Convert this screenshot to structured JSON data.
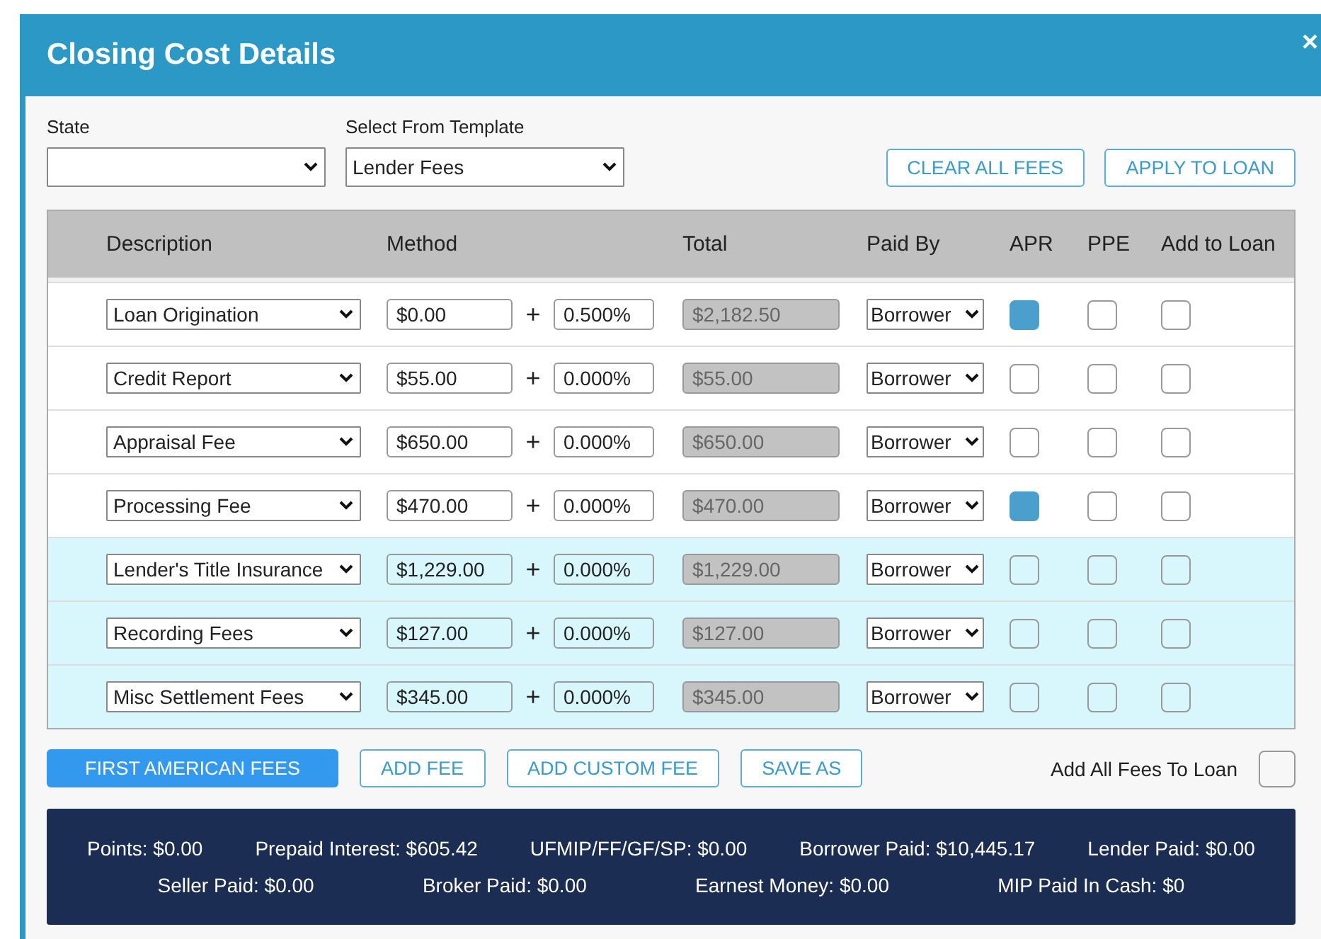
{
  "window": {
    "title": "Closing Cost Details",
    "close": "×"
  },
  "filters": [
    {
      "label": "State"
    },
    {
      "label": "Select From Template",
      "value": "Lender Fees"
    }
  ],
  "top_buttons": [
    "CLEAR ALL FEES",
    "APPLY TO LOAN"
  ],
  "table": {
    "columns": [
      "Description",
      "Method",
      "Total",
      "Paid By",
      "APR",
      "PPE",
      "Add to Loan"
    ],
    "rows": [
      {
        "description": "Loan Origination",
        "amount": "$0.00",
        "plus": "+",
        "percent": "0.500%",
        "total": "$2,182.50",
        "paid_by": "Borrower",
        "apr": true,
        "ppe": false,
        "add_to_loan": false,
        "highlighted": false
      },
      {
        "description": "Credit Report",
        "amount": "$55.00",
        "plus": "+",
        "percent": "0.000%",
        "total": "$55.00",
        "paid_by": "Borrower",
        "apr": false,
        "ppe": false,
        "add_to_loan": false,
        "highlighted": false
      },
      {
        "description": "Appraisal Fee",
        "amount": "$650.00",
        "plus": "+",
        "percent": "0.000%",
        "total": "$650.00",
        "paid_by": "Borrower",
        "apr": false,
        "ppe": false,
        "add_to_loan": false,
        "highlighted": false
      },
      {
        "description": "Processing Fee",
        "amount": "$470.00",
        "plus": "+",
        "percent": "0.000%",
        "total": "$470.00",
        "paid_by": "Borrower",
        "apr": true,
        "ppe": false,
        "add_to_loan": false,
        "highlighted": false
      },
      {
        "description": "Lender's Title Insurance",
        "amount": "$1,229.00",
        "plus": "+",
        "percent": "0.000%",
        "total": "$1,229.00",
        "paid_by": "Borrower",
        "apr": false,
        "ppe": false,
        "add_to_loan": false,
        "highlighted": true
      },
      {
        "description": "Recording Fees",
        "amount": "$127.00",
        "plus": "+",
        "percent": "0.000%",
        "total": "$127.00",
        "paid_by": "Borrower",
        "apr": false,
        "ppe": false,
        "add_to_loan": false,
        "highlighted": true
      },
      {
        "description": "Misc Settlement Fees",
        "amount": "$345.00",
        "plus": "+",
        "percent": "0.000%",
        "total": "$345.00",
        "paid_by": "Borrower",
        "apr": false,
        "ppe": false,
        "add_to_loan": false,
        "highlighted": true
      }
    ]
  },
  "bottom_buttons": [
    {
      "label": "FIRST AMERICAN FEES",
      "primary": true
    },
    {
      "label": "ADD FEE",
      "primary": false
    },
    {
      "label": "ADD CUSTOM FEE",
      "primary": false
    },
    {
      "label": "SAVE AS",
      "primary": false
    }
  ],
  "add_all_fees": {
    "label": "Add All Fees To Loan",
    "checked": false
  },
  "summary": [
    [
      "Points: $0.00",
      "Prepaid Interest: $605.42",
      "UFMIP/FF/GF/SP: $0.00",
      "Borrower Paid: $10,445.17",
      "Lender Paid: $0.00"
    ],
    [
      "Seller Paid: $0.00",
      "Broker Paid: $0.00",
      "Earnest Money: $0.00",
      "MIP Paid In Cash: $0"
    ]
  ]
}
